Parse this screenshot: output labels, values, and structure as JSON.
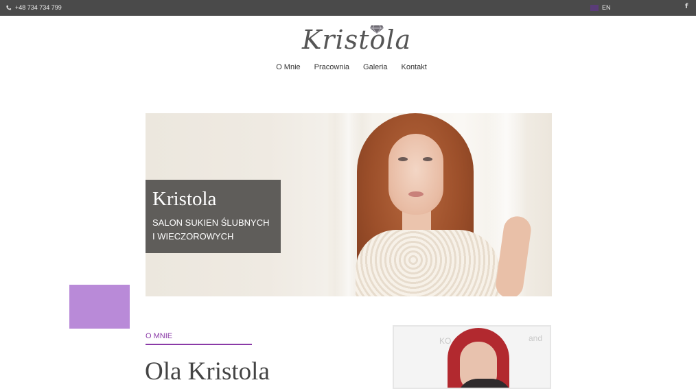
{
  "topbar": {
    "phone": "+48 734 734 799",
    "language": "EN",
    "facebook_icon": "f"
  },
  "logo": {
    "text": "Kristola"
  },
  "nav": {
    "items": [
      "O Mnie",
      "Pracownia",
      "Galeria",
      "Kontakt"
    ]
  },
  "hero": {
    "title": "Kristola",
    "subtitle_line1": "SALON SUKIEN ŚLUBNYCH",
    "subtitle_line2": "I WIECZOROWYCH"
  },
  "about": {
    "label": "O MNIE",
    "title": "Ola Kristola"
  },
  "colors": {
    "topbar": "#4a4a4a",
    "accent": "#8a3aa7",
    "accent_square": "#b98ad8",
    "hero_box": "#5f5d5a"
  },
  "icons": {
    "phone": "phone-icon",
    "flag": "flag-icon",
    "facebook": "facebook-icon",
    "diamond": "diamond-icon"
  }
}
